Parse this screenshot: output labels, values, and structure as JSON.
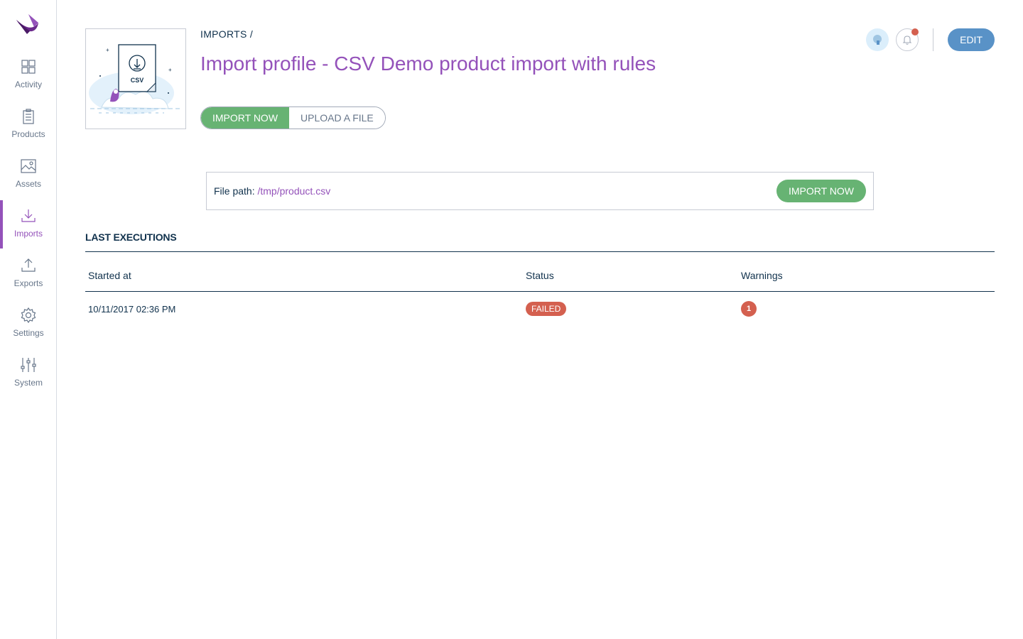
{
  "sidebar": {
    "items": [
      {
        "label": "Activity",
        "icon": "activity-grid-icon"
      },
      {
        "label": "Products",
        "icon": "products-clipboard-icon"
      },
      {
        "label": "Assets",
        "icon": "assets-image-icon"
      },
      {
        "label": "Imports",
        "icon": "imports-download-icon",
        "active": true
      },
      {
        "label": "Exports",
        "icon": "exports-upload-icon"
      },
      {
        "label": "Settings",
        "icon": "settings-gear-icon"
      },
      {
        "label": "System",
        "icon": "system-sliders-icon"
      }
    ]
  },
  "header": {
    "breadcrumb": "IMPORTS /",
    "title": "Import profile - CSV Demo product import with rules",
    "illustration_text": "CSV",
    "import_now_label": "IMPORT NOW",
    "upload_label": "UPLOAD A FILE",
    "edit_label": "EDIT"
  },
  "file": {
    "label": "File path: ",
    "path": "/tmp/product.csv",
    "import_button": "IMPORT NOW"
  },
  "executions": {
    "title": "LAST EXECUTIONS",
    "columns": {
      "started": "Started at",
      "status": "Status",
      "warnings": "Warnings"
    },
    "rows": [
      {
        "started": "10/11/2017 02:36 PM",
        "status": "FAILED",
        "warnings": "1"
      }
    ]
  },
  "colors": {
    "brand_purple": "#9452ba",
    "success_green": "#67b373",
    "edit_blue": "#5992c7",
    "danger_red": "#d4604f",
    "text_dark": "#11324d"
  }
}
